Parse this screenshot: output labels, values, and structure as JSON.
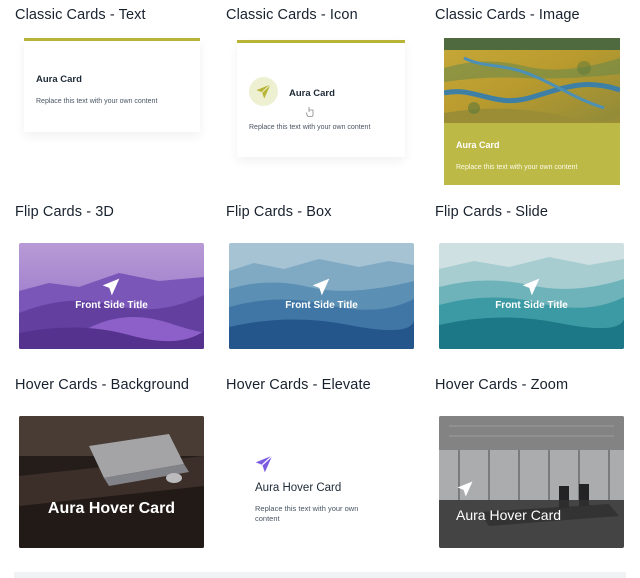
{
  "sections": {
    "classic_text": "Classic Cards - Text",
    "classic_icon": "Classic Cards - Icon",
    "classic_image": "Classic Cards - Image",
    "flip_3d": "Flip Cards - 3D",
    "flip_box": "Flip Cards - Box",
    "flip_slide": "Flip Cards - Slide",
    "hover_background": "Hover Cards - Background",
    "hover_elevate": "Hover Cards - Elevate",
    "hover_zoom": "Hover Cards - Zoom"
  },
  "classic_cards": {
    "text_card": {
      "title": "Aura Card",
      "body": "Replace this text with your own content"
    },
    "icon_card": {
      "title": "Aura Card",
      "body": "Replace this text with your own content",
      "icon": "paper-plane-icon"
    },
    "image_card": {
      "title": "Aura Card",
      "body": "Replace this text with your own content",
      "image": "river-landscape-image"
    }
  },
  "flip_cards": {
    "card_3d": {
      "title": "Front Side Title",
      "icon": "paper-plane-icon",
      "image": "purple-dunes-image"
    },
    "card_box": {
      "title": "Front Side Title",
      "icon": "paper-plane-icon",
      "image": "blue-mountains-image"
    },
    "card_slide": {
      "title": "Front Side Title",
      "icon": "paper-plane-icon",
      "image": "teal-mountains-image"
    }
  },
  "hover_cards": {
    "background_card": {
      "title": "Aura Hover Card",
      "image": "laptop-desk-image"
    },
    "elevate_card": {
      "title": "Aura Hover Card",
      "body": "Replace this text with your own content",
      "icon": "paper-plane-icon"
    },
    "zoom_card": {
      "title": "Aura Hover Card",
      "icon": "paper-plane-icon",
      "image": "conference-room-image"
    }
  },
  "colors": {
    "accent": "#b8b536",
    "image_card_bg": "#bdb947",
    "heading": "#18222e",
    "elevate_icon": "#7b5ce0"
  }
}
